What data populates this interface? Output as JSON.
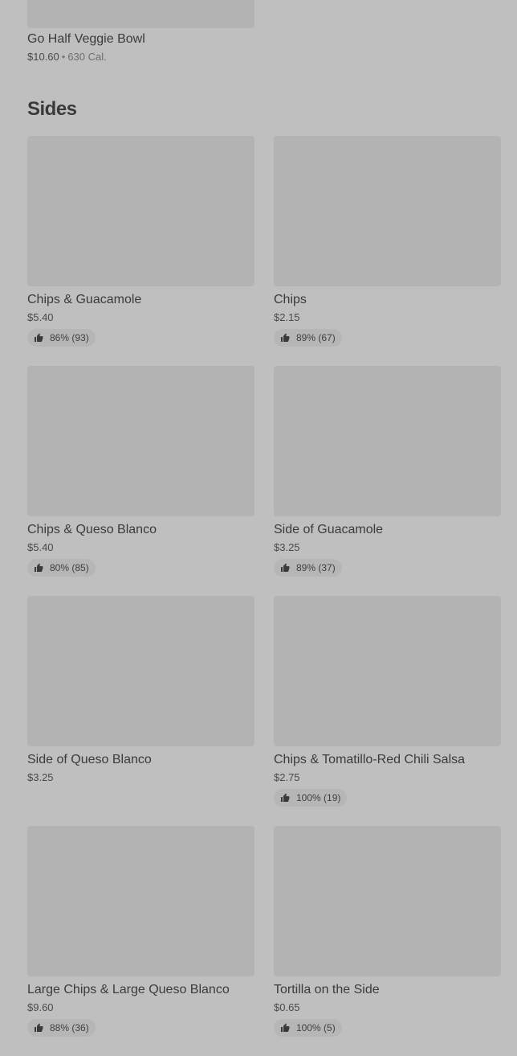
{
  "previous_item": {
    "name": "Go Half Veggie Bowl",
    "price": "$10.60",
    "separator": "•",
    "calories": "630 Cal."
  },
  "sides": {
    "title": "Sides",
    "items": [
      {
        "name": "Chips & Guacamole",
        "price": "$5.40",
        "rating": "86% (93)"
      },
      {
        "name": "Chips",
        "price": "$2.15",
        "rating": "89% (67)"
      },
      {
        "name": "Chips & Queso Blanco",
        "price": "$5.40",
        "rating": "80% (85)"
      },
      {
        "name": "Side of Guacamole",
        "price": "$3.25",
        "rating": "89% (37)"
      },
      {
        "name": "Side of Queso Blanco",
        "price": "$3.25",
        "rating": null
      },
      {
        "name": "Chips & Tomatillo-Red Chili Salsa",
        "price": "$2.75",
        "rating": "100% (19)"
      },
      {
        "name": "Large Chips & Large Queso Blanco",
        "price": "$9.60",
        "rating": "88% (36)"
      },
      {
        "name": "Tortilla on the Side",
        "price": "$0.65",
        "rating": "100% (5)"
      }
    ]
  },
  "icons": {
    "rating": "thumbs-up-icon"
  },
  "colors": {
    "background": "#bfbfbf",
    "image_placeholder": "#b3b3b3",
    "rating_pill": "#b6b6b6",
    "text": "#3a3a3a"
  }
}
